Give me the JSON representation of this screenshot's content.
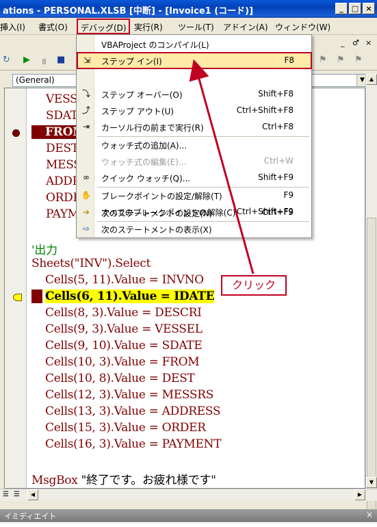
{
  "window": {
    "title": "ations - PERSONAL.XLSB [中断] - [Invoice1 (コード)]",
    "buttons": [
      "_",
      "□",
      "×"
    ]
  },
  "menubar": {
    "items": [
      "挿入(I)",
      "書式(O)",
      "デバッグ(D)",
      "実行(R)",
      "ツール(T)",
      "アドイン(A)",
      "ウィンドウ(W)"
    ],
    "mdi_buttons": [
      "_",
      "♂",
      "×"
    ]
  },
  "code_pane": {
    "object_combo": "(General)",
    "hidden_lines": [
      "VESSE",
      "SDATI",
      "FROM",
      "DEST",
      "MESSI",
      "ADDR",
      "ORDE",
      "PAYM"
    ],
    "comment": "'出力",
    "select_line": "Sheets(\"INV\").Select",
    "cells_lines": [
      "Cells(5, 11).Value = INVNO",
      "Cells(6, 11).Value = IDATE",
      "Cells(8, 3).Value = DESCRI",
      "Cells(9, 3).Value = VESSEL",
      "Cells(9, 10).Value = SDATE",
      "Cells(10, 3).Value = FROM",
      "Cells(10, 8).Value = DEST",
      "Cells(12, 3).Value = MESSRS",
      "Cells(13, 3).Value = ADDRESS",
      "Cells(15, 3).Value = ORDER",
      "Cells(16, 3).Value = PAYMENT"
    ],
    "msgbox_keyword": "MsgBox",
    "msgbox_text": "\"終了です。お疲れ様です\""
  },
  "debug_menu": {
    "items": [
      {
        "label": "VBAProject のコンパイル(L)",
        "shortcut": "",
        "icon": "none"
      },
      {
        "label": "ステップ イン(I)",
        "shortcut": "F8",
        "icon": "step-into-icon"
      },
      {
        "label": "ステップ オーバー(O)",
        "shortcut": "Shift+F8",
        "icon": "step-over-icon"
      },
      {
        "label": "ステップ アウト(U)",
        "shortcut": "Ctrl+Shift+F8",
        "icon": "step-out-icon"
      },
      {
        "label": "カーソル行の前まで実行(R)",
        "shortcut": "Ctrl+F8",
        "icon": "run-to-cursor-icon"
      },
      {
        "label": "ウォッチ式の追加(A)...",
        "shortcut": "",
        "icon": "none"
      },
      {
        "label": "ウォッチ式の編集(E)...",
        "shortcut": "Ctrl+W",
        "icon": "none"
      },
      {
        "label": "クイック ウォッチ(Q)...",
        "shortcut": "Shift+F9",
        "icon": "glasses-icon"
      },
      {
        "label": "ブレークポイントの設定/解除(T)",
        "shortcut": "F9",
        "icon": "hand-icon"
      },
      {
        "label": "すべてのブレークポイントの解除(C)",
        "shortcut": "Ctrl+Shift+F9",
        "icon": "none"
      },
      {
        "label": "次のステートメントの設定(N)",
        "shortcut": "Ctrl+F9",
        "icon": "arrow-icon"
      },
      {
        "label": "次のステートメントの表示(X)",
        "shortcut": "",
        "icon": "show-next-icon"
      }
    ]
  },
  "annotation": {
    "text": "クリック",
    "color": "#c00020"
  },
  "immediate": {
    "title": "イミディエイト"
  },
  "colors": {
    "code": "#800000",
    "comment": "#008000",
    "breakpoint": "#800000",
    "current": "#ffff00"
  }
}
